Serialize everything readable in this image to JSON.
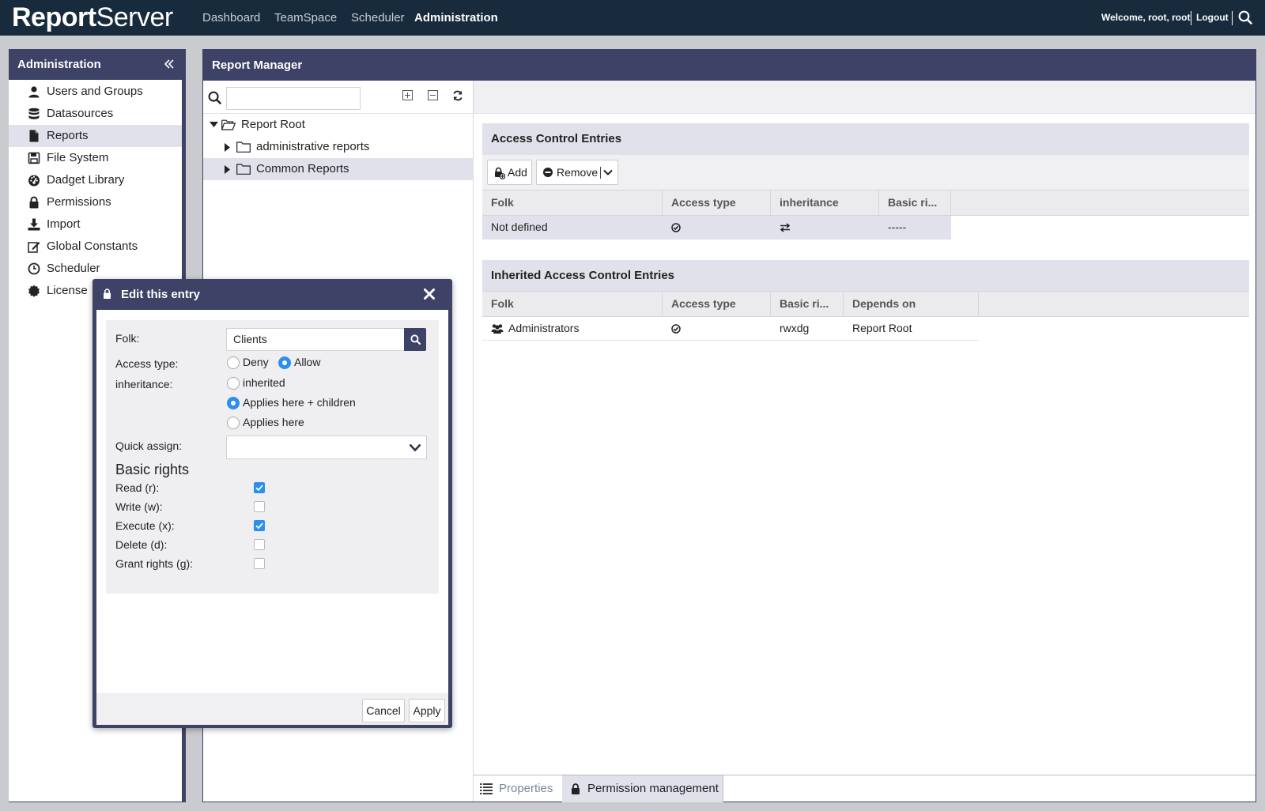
{
  "app": {
    "logo_a": "Report",
    "logo_b": "Server"
  },
  "topnav": {
    "items": [
      "Dashboard",
      "TeamSpace",
      "Scheduler",
      "Administration"
    ],
    "active": "Administration",
    "welcome": "Welcome, root, root",
    "logout": "Logout"
  },
  "sidebar": {
    "title": "Administration",
    "items": [
      {
        "label": "Users and Groups",
        "icon": "user-icon"
      },
      {
        "label": "Datasources",
        "icon": "database-icon"
      },
      {
        "label": "Reports",
        "icon": "report-file-icon",
        "selected": true
      },
      {
        "label": "File System",
        "icon": "save-icon"
      },
      {
        "label": "Dadget Library",
        "icon": "dashboard-gauge-icon"
      },
      {
        "label": "Permissions",
        "icon": "lock-icon"
      },
      {
        "label": "Import",
        "icon": "download-icon"
      },
      {
        "label": "Global Constants",
        "icon": "edit-icon"
      },
      {
        "label": "Scheduler",
        "icon": "clock-icon"
      },
      {
        "label": "License",
        "icon": "certificate-icon"
      }
    ]
  },
  "report_manager": {
    "title": "Report Manager",
    "search_value": "",
    "tree": {
      "root": "Report Root",
      "children": [
        "administrative reports",
        "Common Reports"
      ],
      "selected": "Common Reports"
    }
  },
  "acl": {
    "title": "Access Control Entries",
    "add_label": "Add",
    "remove_label": "Remove",
    "columns": [
      "Folk",
      "Access type",
      "inheritance",
      "Basic ri..."
    ],
    "rows": [
      {
        "folk": "Not defined",
        "access": "check-circle-icon",
        "inheritance": "arrows-exchange-icon",
        "rights": "-----"
      }
    ]
  },
  "inherited_acl": {
    "title": "Inherited Access Control Entries",
    "columns": [
      "Folk",
      "Access type",
      "Basic ri...",
      "Depends on"
    ],
    "rows": [
      {
        "folk": "Administrators",
        "folk_icon": "users-icon",
        "access": "check-circle-icon",
        "rights": "rwxdg",
        "depends_on": "Report Root"
      }
    ]
  },
  "tabs": {
    "properties": "Properties",
    "permissions": "Permission management",
    "active": "Permission management"
  },
  "dialog": {
    "title": "Edit this entry",
    "folk_label": "Folk:",
    "folk_value": "Clients",
    "access_type_label": "Access type:",
    "access_options": [
      "Deny",
      "Allow"
    ],
    "access_selected": "Allow",
    "inheritance_label": "inheritance:",
    "inheritance_options": [
      "inherited",
      "Applies here + children",
      "Applies here"
    ],
    "inheritance_selected": "Applies here + children",
    "quick_assign_label": "Quick assign:",
    "quick_assign_value": "",
    "basic_rights_title": "Basic rights",
    "rights": [
      {
        "label": "Read (r):",
        "checked": true
      },
      {
        "label": "Write (w):",
        "checked": false
      },
      {
        "label": "Execute (x):",
        "checked": true
      },
      {
        "label": "Delete (d):",
        "checked": false
      },
      {
        "label": "Grant rights (g):",
        "checked": false
      }
    ],
    "cancel_label": "Cancel",
    "apply_label": "Apply"
  },
  "colors": {
    "navy": "#172b3d",
    "panel_header": "#3d4266",
    "selection": "#e0e1eb",
    "checkbox_blue": "#2c8ff0"
  }
}
